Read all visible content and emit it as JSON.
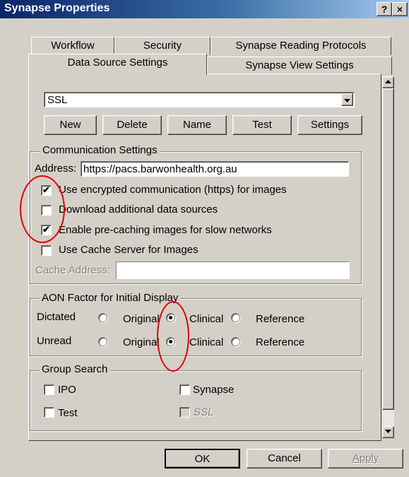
{
  "window": {
    "title": "Synapse Properties",
    "help_label": "?",
    "close_label": "×"
  },
  "tabs_row1": [
    "Workflow",
    "Security",
    "Synapse Reading Protocols"
  ],
  "tabs_row2": [
    "Data Source Settings",
    "Synapse View Settings"
  ],
  "datasource": {
    "selected": "SSL"
  },
  "ds_buttons": [
    "New",
    "Delete",
    "Name",
    "Test",
    "Settings"
  ],
  "comm": {
    "legend": "Communication Settings",
    "address_label": "Address:",
    "address_value": "https://pacs.barwonhealth.org.au",
    "options": [
      {
        "label": "Use encrypted communication (https) for images",
        "checked": true
      },
      {
        "label": "Download additional data sources",
        "checked": false
      },
      {
        "label": "Enable pre-caching images for slow networks",
        "checked": true
      },
      {
        "label": "Use Cache Server for Images",
        "checked": false
      }
    ],
    "cache_label": "Cache Address:",
    "cache_value": ""
  },
  "aon": {
    "legend": "AON Factor for Initial Display",
    "row_labels": [
      "Dictated",
      "Unread"
    ],
    "choices": [
      "Original",
      "Clinical",
      "Reference"
    ],
    "selected": "Clinical"
  },
  "group_search": {
    "legend": "Group Search",
    "items": [
      {
        "label": "IPO",
        "checked": false
      },
      {
        "label": "Synapse",
        "checked": false
      },
      {
        "label": "Test",
        "checked": false
      },
      {
        "label": "SSL",
        "checked": false,
        "disabled": true
      }
    ]
  },
  "footer": {
    "ok": "OK",
    "cancel": "Cancel",
    "apply": "Apply"
  },
  "annotation_color": "#e00000"
}
